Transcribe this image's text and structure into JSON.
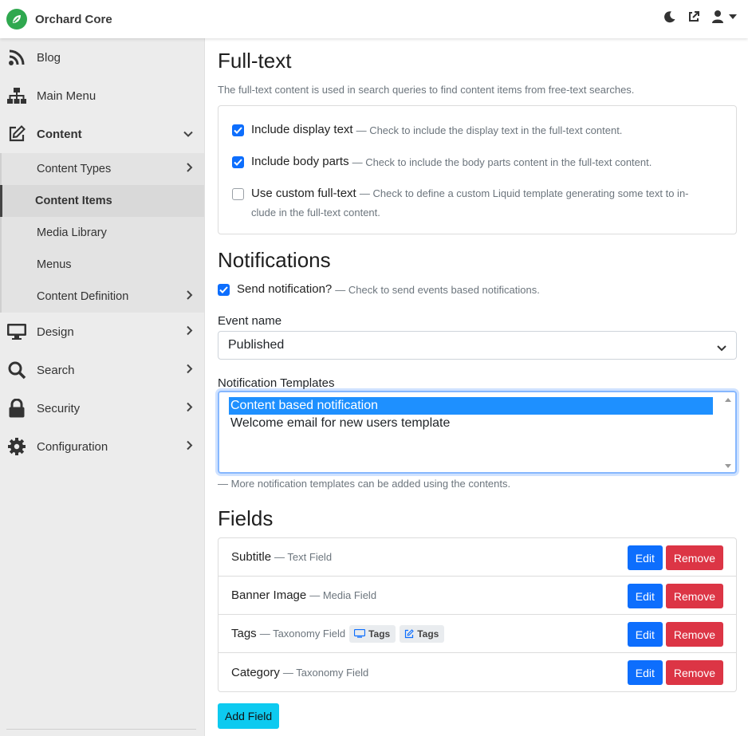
{
  "app": {
    "title": "Orchard Core"
  },
  "topbar": {
    "icons": [
      "moon-icon",
      "external-link-icon",
      "user-icon",
      "caret-down-icon"
    ]
  },
  "sidebar": {
    "items": [
      {
        "label": "Blog",
        "icon": "rss-icon"
      },
      {
        "label": "Main Menu",
        "icon": "sitemap-icon"
      },
      {
        "label": "Content",
        "icon": "edit-icon"
      },
      {
        "label": "Design",
        "icon": "monitor-icon"
      },
      {
        "label": "Search",
        "icon": "search-icon"
      },
      {
        "label": "Security",
        "icon": "lock-icon"
      },
      {
        "label": "Configuration",
        "icon": "gear-icon"
      }
    ],
    "content_sub": [
      {
        "label": "Content Types"
      },
      {
        "label": "Content Items"
      },
      {
        "label": "Media Library"
      },
      {
        "label": "Menus"
      },
      {
        "label": "Content Definition"
      }
    ]
  },
  "fulltext": {
    "heading": "Full-text",
    "description": "The full-text content is used in search queries to find content items from free-text searches.",
    "options": [
      {
        "label": "Include display text",
        "hint": "— Check to include the display text in the full-text content.",
        "checked": true
      },
      {
        "label": "Include body parts",
        "hint": "— Check to include the body parts content in the full-text content.",
        "checked": true
      },
      {
        "label": "Use custom full-text",
        "hint_1": "— Check to define a custom Liquid template generating some text to in-",
        "hint_2": "clude in the full-text content.",
        "checked": false
      }
    ]
  },
  "notifications": {
    "heading": "Notifications",
    "send_label": "Send notification?",
    "send_hint": "— Check to send events based notifications.",
    "send_checked": true,
    "event_label": "Event name",
    "event_value": "Published",
    "templates_label": "Notification Templates",
    "templates": [
      {
        "label": "Content based notification",
        "selected": true
      },
      {
        "label": "Welcome email for new users template",
        "selected": false
      }
    ],
    "templates_hint": "— More notification templates can be added using the contents."
  },
  "fields": {
    "heading": "Fields",
    "rows": [
      {
        "name": "Subtitle",
        "type": "— Text Field"
      },
      {
        "name": "Banner Image",
        "type": "— Media Field"
      },
      {
        "name": "Tags",
        "type": "— Taxonomy Field",
        "tags": [
          "Tags",
          "Tags"
        ]
      },
      {
        "name": "Category",
        "type": "— Taxonomy Field"
      }
    ],
    "edit_label": "Edit",
    "remove_label": "Remove",
    "add_label": "Add Field"
  },
  "colors": {
    "primary": "#0d6efd",
    "danger": "#dc3545",
    "info": "#0dcaf0",
    "brand": "#2fa84f"
  }
}
